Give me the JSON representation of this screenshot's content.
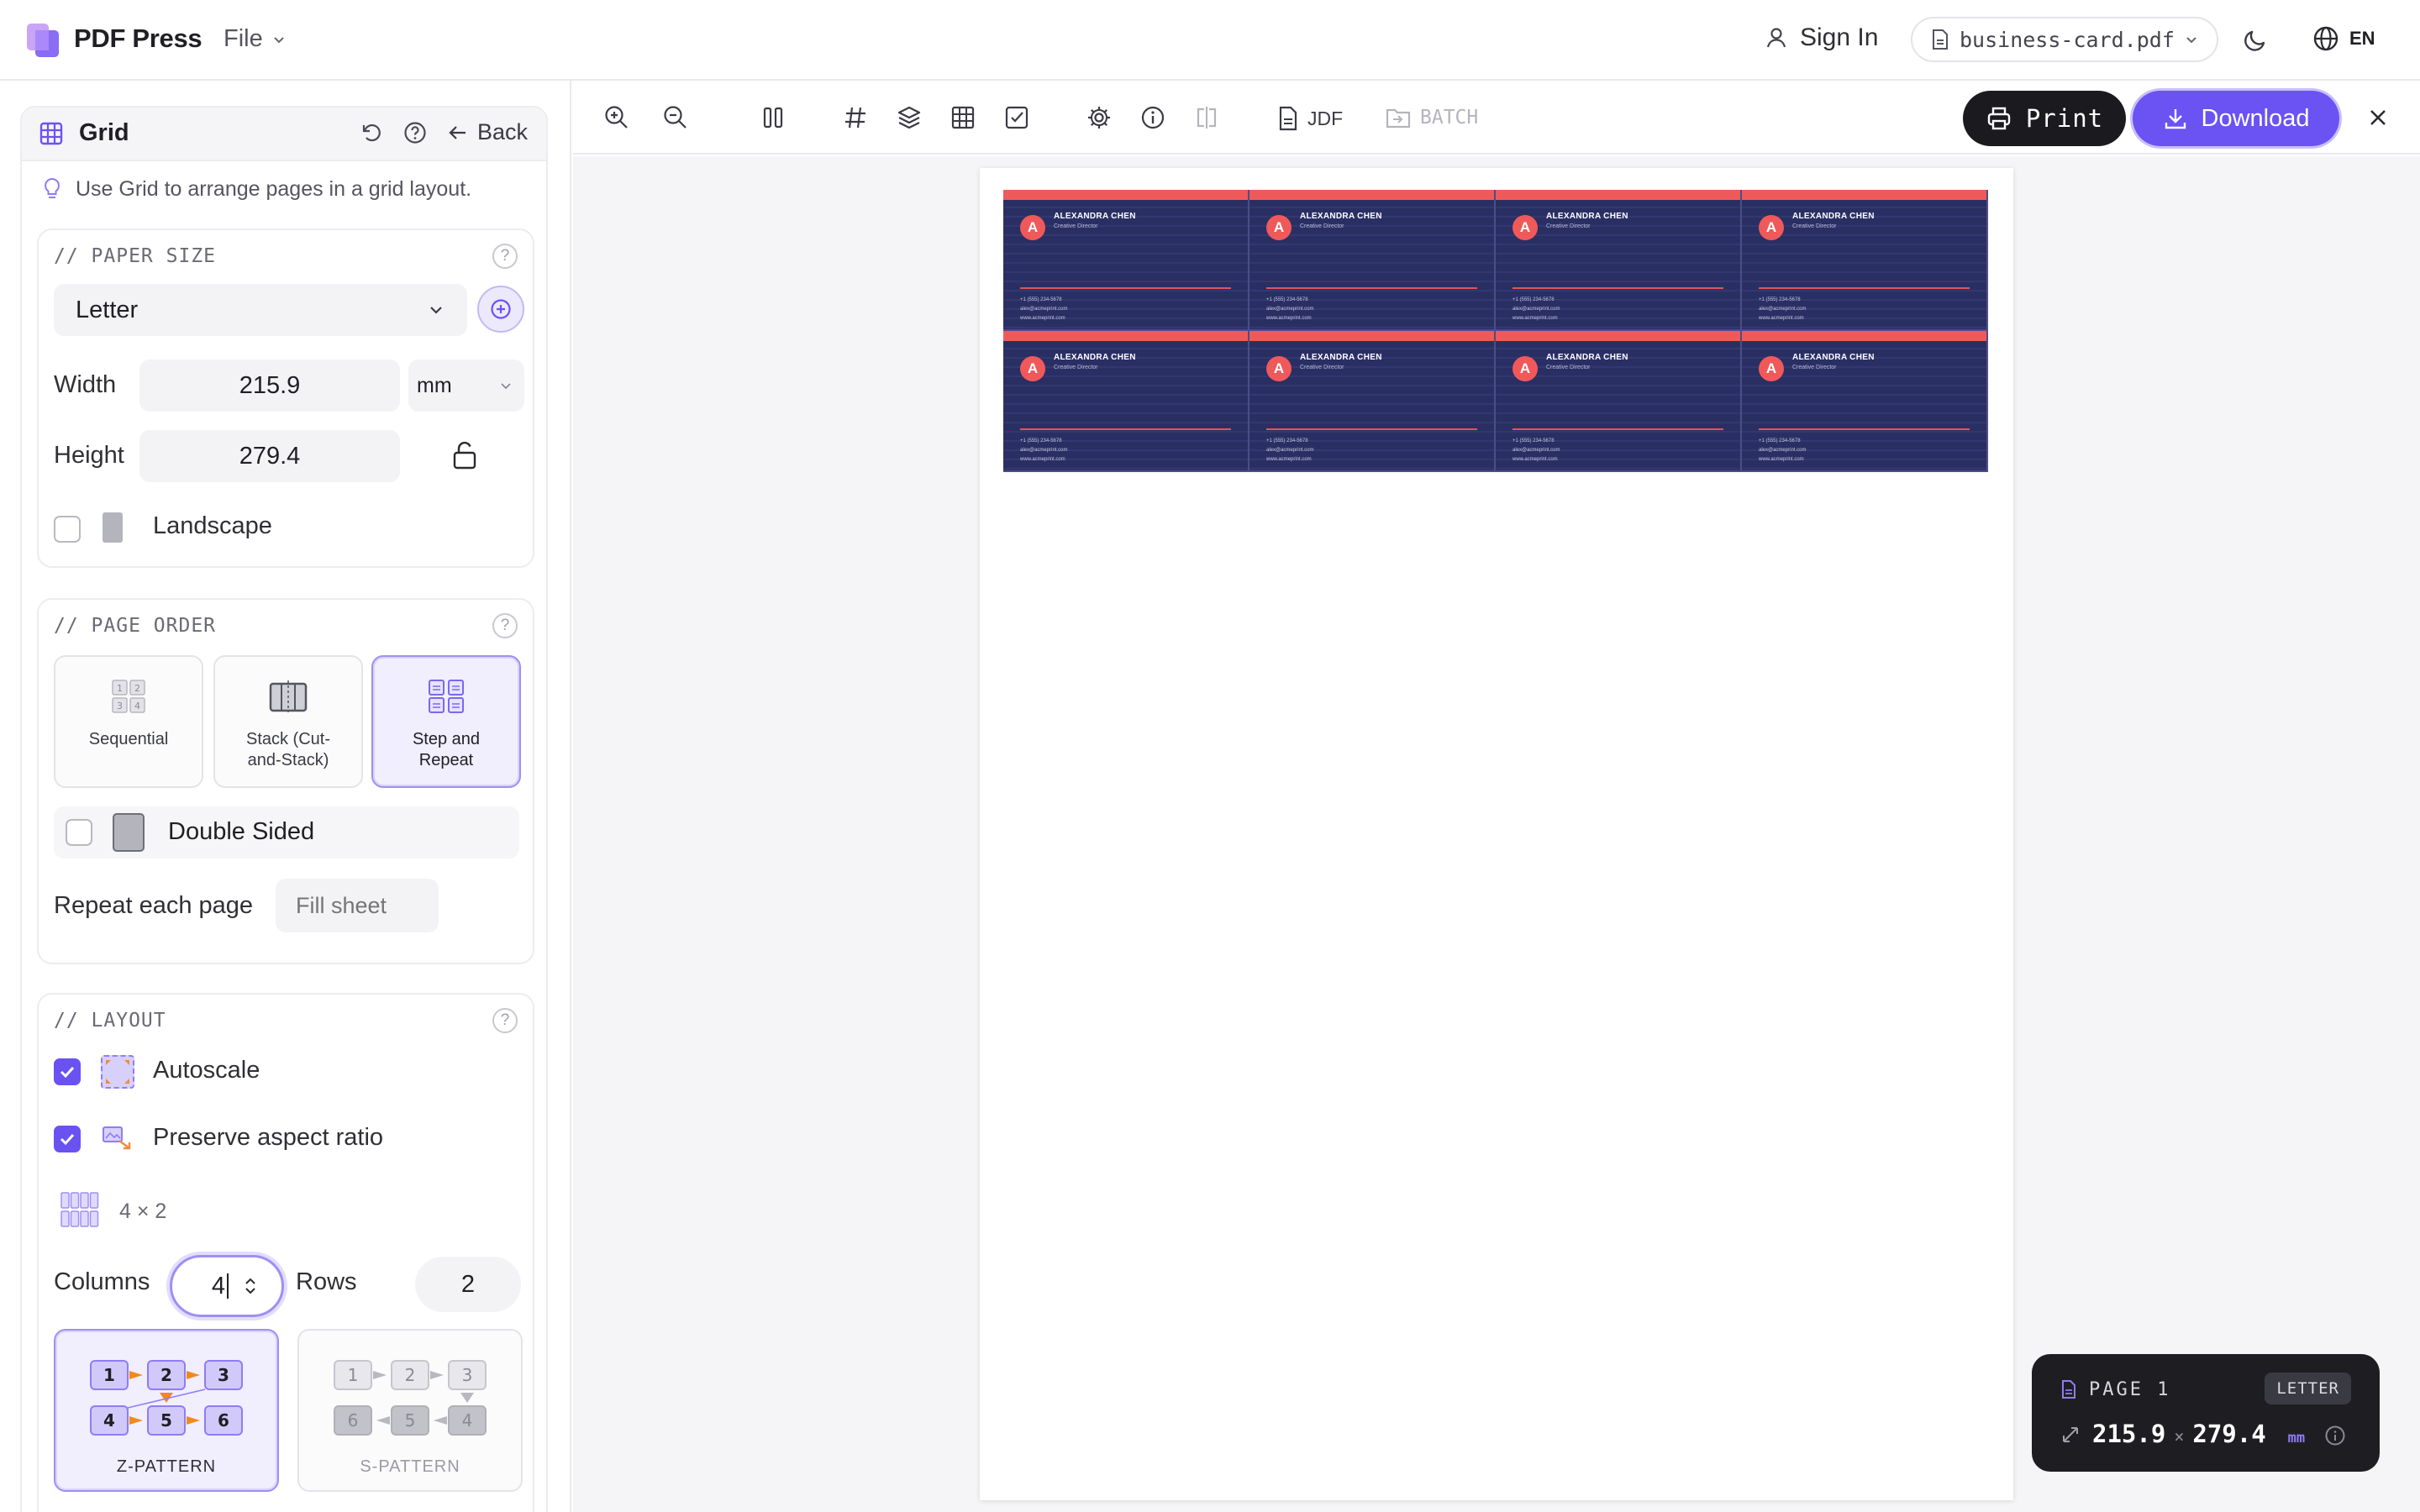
{
  "app": {
    "name": "PDF Press",
    "file_menu": "File",
    "sign_in": "Sign In",
    "current_file": "business-card.pdf",
    "language": "EN"
  },
  "sidebar": {
    "title": "Grid",
    "back_label": "Back",
    "tip": "Use Grid to arrange pages in a grid layout.",
    "paper_size": {
      "section_label": "// PAPER SIZE",
      "selected": "Letter",
      "width_label": "Width",
      "width_value": "215.9",
      "unit": "mm",
      "height_label": "Height",
      "height_value": "279.4",
      "landscape_label": "Landscape",
      "landscape_checked": false
    },
    "page_order": {
      "section_label": "// PAGE ORDER",
      "options": [
        {
          "label": "Sequential",
          "selected": false
        },
        {
          "label": "Stack (Cut-and-Stack)",
          "selected": false
        },
        {
          "label": "Step and Repeat",
          "selected": true
        }
      ],
      "double_sided_label": "Double Sided",
      "double_sided_checked": false,
      "repeat_label": "Repeat each page",
      "repeat_placeholder": "Fill sheet"
    },
    "layout": {
      "section_label": "// LAYOUT",
      "autoscale_label": "Autoscale",
      "autoscale_checked": true,
      "preserve_label": "Preserve aspect ratio",
      "preserve_checked": true,
      "grid_summary": "4 × 2",
      "columns_label": "Columns",
      "columns_value": "4",
      "rows_label": "Rows",
      "rows_value": "2",
      "patterns": [
        {
          "label": "Z-PATTERN",
          "selected": true,
          "cells": [
            "1",
            "2",
            "3",
            "4",
            "5",
            "6"
          ]
        },
        {
          "label": "S-PATTERN",
          "selected": false,
          "cells": [
            "1",
            "2",
            "3",
            "6",
            "5",
            "4"
          ]
        }
      ]
    }
  },
  "toolbar": {
    "jdf_label": "JDF",
    "batch_label": "BATCH",
    "print_label": "Print",
    "download_label": "Download"
  },
  "preview": {
    "card": {
      "initial": "A",
      "name": "ALEXANDRA CHEN",
      "role": "Creative Director",
      "phone": "+1 (555) 234-5678",
      "email": "alex@acmeprint.com",
      "web": "www.acmeprint.com"
    },
    "card_count": 8
  },
  "page_info": {
    "page_label": "PAGE 1",
    "size_badge": "LETTER",
    "width": "215.9",
    "height": "279.4",
    "unit": "mm",
    "separator": "×"
  },
  "colors": {
    "accent": "#6b52f3",
    "card_bg": "#2a2f63",
    "card_accent": "#f0595a"
  }
}
